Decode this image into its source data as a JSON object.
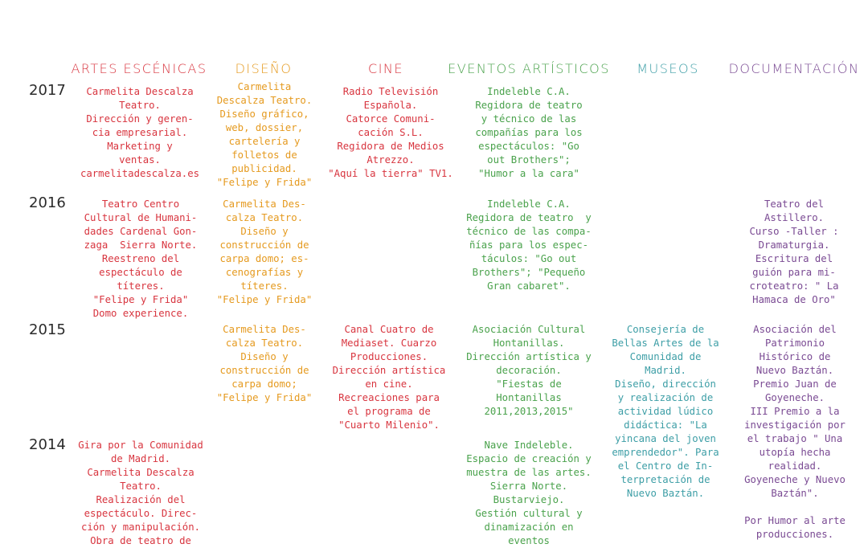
{
  "colors": {
    "artes": "#d8353f",
    "diseno": "#e59a1f",
    "cine": "#d8353f",
    "eventos": "#4aa24c",
    "museos": "#3d9ea6",
    "documentacion": "#7a4a93",
    "year": "#2b2b2b"
  },
  "headers": {
    "artes": "ARTES ESCÉNICAS",
    "diseno": "DISEÑO",
    "cine": "CINE",
    "eventos": "EVENTOS ARTÍSTICOS",
    "museos": "MUSEOS",
    "documentacion": "DOCUMENTACIÓN"
  },
  "years": {
    "y2017": "2017",
    "y2016": "2016",
    "y2015": "2015",
    "y2014": "2014"
  },
  "cells": {
    "y2017": {
      "artes": "Carmelita Descalza\nTeatro.\nDirección y geren-\ncia empresarial.\nMarketing y\nventas.\ncarmelitadescalza.es",
      "diseno": "Carmelita\nDescalza Teatro.\nDiseño gráfico,\nweb, dossier,\ncartelería y\nfolletos de\npublicidad.\n\"Felipe y Frida\"",
      "cine": "Radio Televisión\nEspañola.\nCatorce Comuni-\ncación S.L.\nRegidora de Medios\nAtrezzo.\n\"Aquí la tierra\" TV1.",
      "eventos": "Indeleble C.A.\nRegidora de teatro\ny técnico de las\ncompañías para los\nespectáculos: \"Go\nout Brothers\";\n\"Humor a la cara\""
    },
    "y2016": {
      "artes": "Teatro Centro\nCultural de Humani-\ndades Cardenal Gon-\nzaga  Sierra Norte.\nReestreno del\nespectáculo de\ntíteres.\n\"Felipe y Frida\"\nDomo experience.",
      "diseno": "Carmelita Des-\ncalza Teatro.\nDiseño y\nconstrucción de\ncarpa domo; es-\ncenografías y\ntíteres.\n\"Felipe y Frida\"",
      "eventos": "Indeleble C.A.\nRegidora de teatro  y\ntécnico de las compa-\nñías para los espec-\ntáculos: \"Go out\nBrothers\"; \"Pequeño\nGran cabaret\".",
      "documentacion": "Teatro del\nAstillero.\nCurso -Taller :\nDramaturgia.\nEscritura del\nguión para mi-\ncroteatro: \" La\nHamaca de Oro\""
    },
    "y2015": {
      "diseno": "Carmelita Des-\ncalza Teatro.\nDiseño y\nconstrucción de\ncarpa domo;\n\"Felipe y Frida\"",
      "cine": "Canal Cuatro de\nMediaset. Cuarzo\nProducciones.\nDirección artística\nen cine.\nRecreaciones para\nel programa de\n\"Cuarto Milenio\".",
      "eventos": "Asociación Cultural\nHontanillas.\nDirección artística y\ndecoración.\n\"Fiestas de\nHontanillas\n2011,2013,2015\"",
      "museos": "Consejería de\nBellas Artes de la\nComunidad de\nMadrid.\nDiseño, dirección\ny realización de\nactividad lúdico\ndidáctica: \"La\nyincana del joven\nemprendedor\". Para\nel Centro de In-\nterpretación de\nNuevo Baztán.",
      "documentacion": "Asociación del\nPatrimonio\nHistórico de\nNuevo Baztán.\nPremio Juan de\nGoyeneche.\nIII Premio a la\ninvestigación por\nel trabajo \" Una\nutopía hecha\nrealidad.\nGoyeneche y Nuevo\nBaztán\".\n\nPor Humor al arte\nproducciones."
    },
    "y2014": {
      "artes": "Gira por la Comunidad\nde Madrid.\nCarmelita Descalza\nTeatro.\nRealización del\nespectáculo. Direc-\nción y manipulación.\nObra de teatro de",
      "eventos": "Nave Indeleble.\nEspacio de creación y\nmuestra de las artes.\nSierra Norte.\nBustarviejo.\nGestión cultural y\ndinamización en\neventos"
    }
  }
}
